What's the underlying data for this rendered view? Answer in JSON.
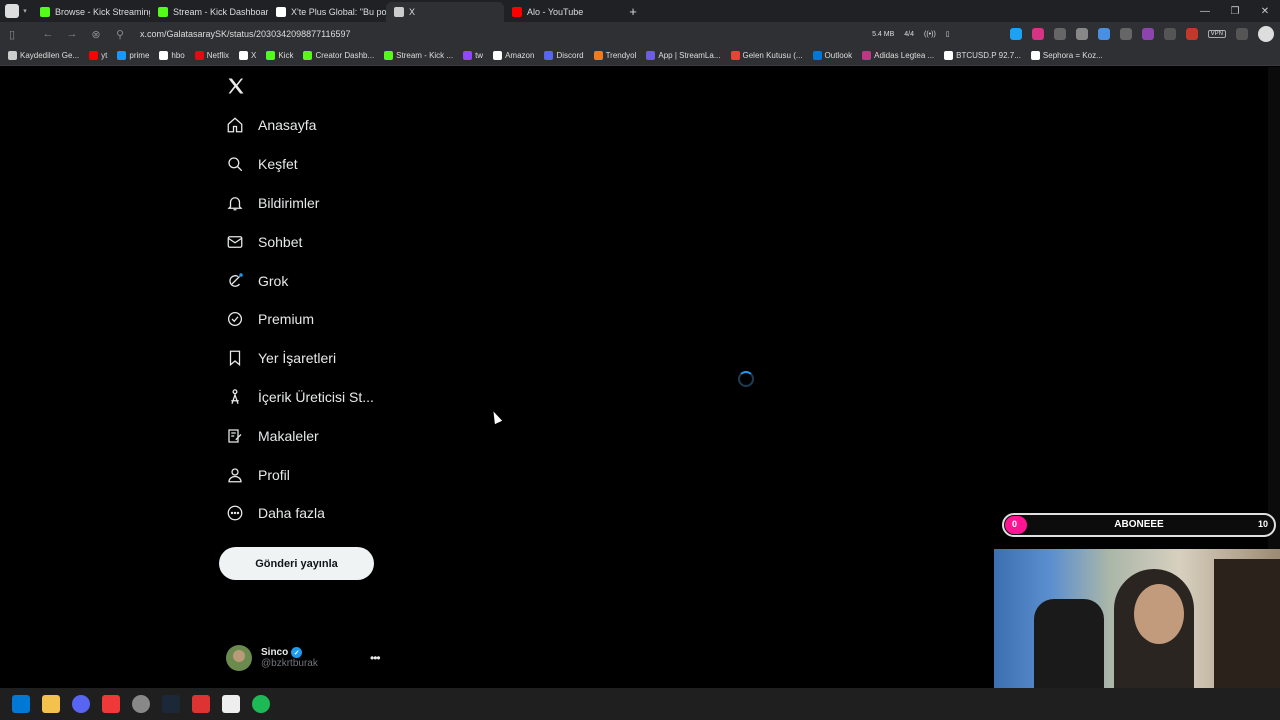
{
  "browser": {
    "tabs": [
      {
        "title": "Browse - Kick Streaming",
        "icon": "kick-icon",
        "color": "#53fc18"
      },
      {
        "title": "Stream - Kick Dashboard",
        "icon": "kick-icon",
        "color": "#53fc18"
      },
      {
        "title": "X'te Plus Global: \"Bu pozisy",
        "icon": "x-icon",
        "color": "#ffffff"
      },
      {
        "title": "X",
        "icon": "page-icon",
        "color": "#cccccc"
      },
      {
        "title": "Alo - YouTube",
        "icon": "youtube-icon",
        "color": "#ff0000"
      }
    ],
    "active_tab": 3,
    "url": "x.com/GalatasaraySK/status/2030342098877116597",
    "memory": "5.4 MB",
    "tab_count": "4/4",
    "vpn_label": "VPN",
    "bookmarks": [
      {
        "label": "Kaydedilen Ge...",
        "color": "#cccccc"
      },
      {
        "label": "yt",
        "color": "#ff0000"
      },
      {
        "label": "prime",
        "color": "#1399ff"
      },
      {
        "label": "hbo",
        "color": "#ffffff"
      },
      {
        "label": "Netflix",
        "color": "#e50914"
      },
      {
        "label": "X",
        "color": "#ffffff"
      },
      {
        "label": "Kick",
        "color": "#53fc18"
      },
      {
        "label": "Creator Dashb...",
        "color": "#53fc18"
      },
      {
        "label": "Stream - Kick ...",
        "color": "#53fc18"
      },
      {
        "label": "tw",
        "color": "#9146ff"
      },
      {
        "label": "Amazon",
        "color": "#ffffff"
      },
      {
        "label": "Discord",
        "color": "#5865f2"
      },
      {
        "label": "Trendyol",
        "color": "#f27a1a"
      },
      {
        "label": "App | StreamLa...",
        "color": "#6c5ce7"
      },
      {
        "label": "Gelen Kutusu (...",
        "color": "#ea4335"
      },
      {
        "label": "Outlook",
        "color": "#0078d4"
      },
      {
        "label": "Adidas Legtea ...",
        "color": "#c13584"
      },
      {
        "label": "BTCUSD.P 92.7...",
        "color": "#ffffff"
      },
      {
        "label": "Sephora = Koz...",
        "color": "#ffffff"
      }
    ]
  },
  "x": {
    "logo_icon": "x-logo-icon",
    "nav": [
      {
        "label": "Anasayfa",
        "icon": "home-icon"
      },
      {
        "label": "Keşfet",
        "icon": "search-icon"
      },
      {
        "label": "Bildirimler",
        "icon": "bell-icon"
      },
      {
        "label": "Sohbet",
        "icon": "mail-icon"
      },
      {
        "label": "Grok",
        "icon": "grok-icon"
      },
      {
        "label": "Premium",
        "icon": "premium-icon"
      },
      {
        "label": "Yer İşaretleri",
        "icon": "bookmark-icon"
      },
      {
        "label": "İçerik Üreticisi St...",
        "icon": "creator-studio-icon"
      },
      {
        "label": "Makaleler",
        "icon": "articles-icon"
      },
      {
        "label": "Profil",
        "icon": "profile-icon"
      },
      {
        "label": "Daha fazla",
        "icon": "more-circle-icon"
      }
    ],
    "post_button": "Gönderi yayınla",
    "user": {
      "name": "Sinco",
      "handle": "@bzkrtburak",
      "verified": true
    },
    "loading": true
  },
  "overlay": {
    "goal_label": "ABONEEE",
    "goal_current": "0",
    "goal_target": "10",
    "goal_progress_percent": 0,
    "goal_color": "#ff1493"
  }
}
